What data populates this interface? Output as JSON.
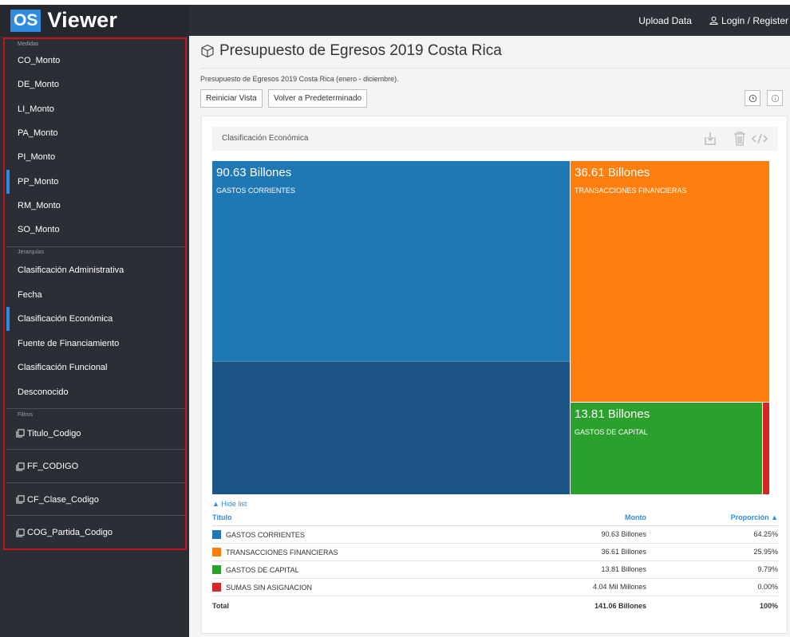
{
  "app": {
    "logo_badge": "OS",
    "logo_text": "Viewer",
    "upload_label": "Upload Data",
    "login_label": "Login / Register"
  },
  "sidebar": {
    "measures_label": "Medidas",
    "measures": [
      "CO_Monto",
      "DE_Monto",
      "LI_Monto",
      "PA_Monto",
      "PI_Monto",
      "PP_Monto",
      "RM_Monto",
      "SO_Monto"
    ],
    "active_measure": "PP_Monto",
    "hierarchies_label": "Jerarquías",
    "hierarchies": [
      "Clasificación Administrativa",
      "Fecha",
      "Clasificación Económica",
      "Fuente de Financiamiento",
      "Clasificación Funcional",
      "Desconocido"
    ],
    "active_hierarchy": "Clasificación Económica",
    "filters_label": "Filtros",
    "filters": [
      "Titulo_Codigo",
      "FF_CODIGO",
      "CF_Clase_Codigo",
      "COG_Partida_Codigo"
    ]
  },
  "main": {
    "title": "Presupuesto de Egresos 2019 Costa Rica",
    "description": "Presupuesto de Egresos 2019 Costa Rica (enero - diciembre).",
    "reset_label": "Reiniciar Vista",
    "default_label": "Volver a Predeterminado",
    "panel_title": "Clasificación Económica"
  },
  "treemap": {
    "items": [
      {
        "value_label": "90.63 Billones",
        "name": "GASTOS CORRIENTES",
        "color": "#1f77b4",
        "value": 90.63
      },
      {
        "value_label": "36.61 Billones",
        "name": "TRANSACCIONES FINANCIERAS",
        "color": "#ff7f0e",
        "value": 36.61
      },
      {
        "value_label": "13.81 Billones",
        "name": "GASTOS DE CAPITAL",
        "color": "#2ca02c",
        "value": 13.81
      },
      {
        "value_label": "",
        "name": "",
        "color": "#d62728",
        "value": 0.004
      }
    ],
    "sub_shade_color": "#1b5586"
  },
  "list": {
    "hide_label": "▲ Hide list",
    "headers": {
      "title": "Título",
      "monto": "Monto",
      "prop": "Proporción ▲"
    },
    "rows": [
      {
        "title": "GASTOS CORRIENTES",
        "monto": "90.63 Billones",
        "prop": "64.25%",
        "color": "#1f77b4"
      },
      {
        "title": "TRANSACCIONES FINANCIERAS",
        "monto": "36.61 Billones",
        "prop": "25.95%",
        "color": "#ff7f0e"
      },
      {
        "title": "GASTOS DE CAPITAL",
        "monto": "13.81 Billones",
        "prop": "9.79%",
        "color": "#2ca02c"
      },
      {
        "title": "SUMAS SIN ASIGNACION",
        "monto": "4.04 Mil Millones",
        "prop": "0.00%",
        "color": "#d62728"
      }
    ],
    "total": {
      "title": "Total",
      "monto": "141.06 Billones",
      "prop": "100%"
    }
  }
}
